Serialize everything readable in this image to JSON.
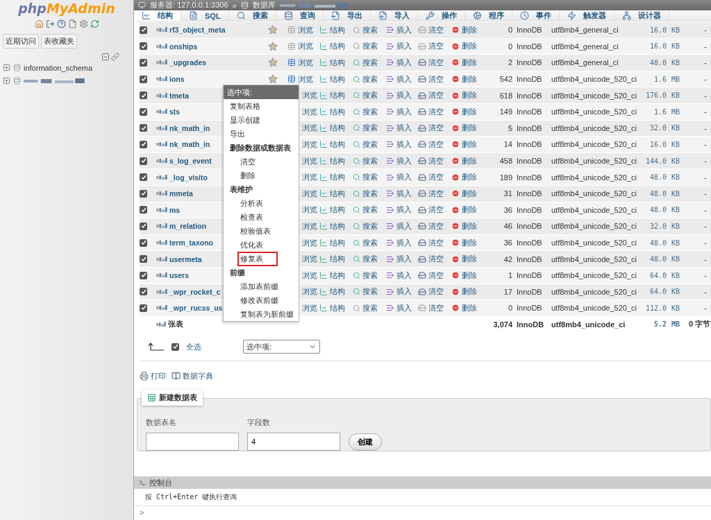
{
  "sidebar": {
    "logo": {
      "php": "php",
      "rest": "MyAdmin"
    },
    "buttons": [
      "近期访问",
      "表收藏夹"
    ],
    "tree": [
      {
        "label": "information_schema",
        "blurred": false
      },
      {
        "blurred": true
      }
    ]
  },
  "breadcrumb": {
    "server_label": "服务器:",
    "server": "127.0.0.1:3306",
    "separator": "»",
    "database_label": "数据库"
  },
  "tabs": [
    {
      "label": "结构",
      "kind": "structure",
      "selected": true
    },
    {
      "label": "SQL",
      "kind": "sql",
      "selected": false
    },
    {
      "label": "搜索",
      "kind": "search",
      "selected": false
    },
    {
      "label": "查询",
      "kind": "query",
      "selected": false
    },
    {
      "label": "导出",
      "kind": "export",
      "selected": false
    },
    {
      "label": "导入",
      "kind": "import",
      "selected": false
    },
    {
      "label": "操作",
      "kind": "operations",
      "selected": false
    },
    {
      "label": "程序",
      "kind": "routines",
      "selected": false
    },
    {
      "label": "事件",
      "kind": "events",
      "selected": false
    },
    {
      "label": "触发器",
      "kind": "triggers",
      "selected": false
    },
    {
      "label": "设计器",
      "kind": "designer",
      "selected": false
    }
  ],
  "rows": [
    {
      "name": "rf3_object_meta",
      "checked": true,
      "covered": false,
      "empty": true,
      "actions": [
        "浏览",
        "结构",
        "搜索",
        "插入",
        "清空",
        "删除"
      ],
      "rows": "0",
      "engine": "InnoDB",
      "collation": "utf8mb4_general_ci",
      "size": "16.0",
      "unit": "KB",
      "overhead": "-"
    },
    {
      "name": "onships",
      "checked": true,
      "covered": false,
      "empty": true,
      "actions": [
        "浏览",
        "结构",
        "搜索",
        "插入",
        "清空",
        "删除"
      ],
      "rows": "0",
      "engine": "InnoDB",
      "collation": "utf8mb4_general_ci",
      "size": "16.0",
      "unit": "KB",
      "overhead": "-"
    },
    {
      "name": "_upgrades",
      "checked": true,
      "covered": false,
      "empty": false,
      "actions": [
        "浏览",
        "结构",
        "搜索",
        "插入",
        "清空",
        "删除"
      ],
      "rows": "2",
      "engine": "InnoDB",
      "collation": "utf8mb4_general_ci",
      "size": "48.0",
      "unit": "KB",
      "overhead": "-"
    },
    {
      "name": "ions",
      "checked": true,
      "covered": false,
      "empty": false,
      "actions": [
        "浏览",
        "结构",
        "搜索",
        "插入",
        "清空",
        "删除"
      ],
      "rows": "542",
      "engine": "InnoDB",
      "collation": "utf8mb4_unicode_520_ci",
      "size": "1.6",
      "unit": "MB",
      "overhead": "-"
    },
    {
      "name": "tmeta",
      "checked": true,
      "covered": true,
      "empty": false,
      "actions": [
        "浏览",
        "结构",
        "搜索",
        "插入",
        "清空",
        "删除"
      ],
      "rows": "618",
      "engine": "InnoDB",
      "collation": "utf8mb4_unicode_520_ci",
      "size": "176.0",
      "unit": "KB",
      "overhead": "-"
    },
    {
      "name": "sts",
      "checked": true,
      "covered": true,
      "empty": false,
      "actions": [
        "浏览",
        "结构",
        "搜索",
        "插入",
        "清空",
        "删除"
      ],
      "rows": "149",
      "engine": "InnoDB",
      "collation": "utf8mb4_unicode_520_ci",
      "size": "1.6",
      "unit": "MB",
      "overhead": "-"
    },
    {
      "name": "nk_math_in",
      "checked": true,
      "covered": true,
      "empty": false,
      "actions": [
        "浏览",
        "结构",
        "搜索",
        "插入",
        "清空",
        "删除"
      ],
      "rows": "5",
      "engine": "InnoDB",
      "collation": "utf8mb4_unicode_520_ci",
      "size": "32.0",
      "unit": "KB",
      "overhead": "-"
    },
    {
      "name": "nk_math_in",
      "checked": true,
      "covered": true,
      "empty": false,
      "actions": [
        "浏览",
        "结构",
        "搜索",
        "插入",
        "清空",
        "删除"
      ],
      "rows": "14",
      "engine": "InnoDB",
      "collation": "utf8mb4_unicode_520_ci",
      "size": "16.0",
      "unit": "KB",
      "overhead": "-"
    },
    {
      "name": "s_log_event",
      "checked": true,
      "covered": true,
      "empty": false,
      "actions": [
        "浏览",
        "结构",
        "搜索",
        "插入",
        "清空",
        "删除"
      ],
      "rows": "458",
      "engine": "InnoDB",
      "collation": "utf8mb4_unicode_520_ci",
      "size": "144.0",
      "unit": "KB",
      "overhead": "-"
    },
    {
      "name": "_log_visito",
      "checked": true,
      "covered": true,
      "empty": false,
      "actions": [
        "浏览",
        "结构",
        "搜索",
        "插入",
        "清空",
        "删除"
      ],
      "rows": "189",
      "engine": "InnoDB",
      "collation": "utf8mb4_unicode_520_ci",
      "size": "48.0",
      "unit": "KB",
      "overhead": "-"
    },
    {
      "name": "mmeta",
      "checked": true,
      "covered": true,
      "empty": false,
      "actions": [
        "浏览",
        "结构",
        "搜索",
        "插入",
        "清空",
        "删除"
      ],
      "rows": "31",
      "engine": "InnoDB",
      "collation": "utf8mb4_unicode_520_ci",
      "size": "48.0",
      "unit": "KB",
      "overhead": "-"
    },
    {
      "name": "ms",
      "checked": true,
      "covered": true,
      "empty": false,
      "actions": [
        "浏览",
        "结构",
        "搜索",
        "插入",
        "清空",
        "删除"
      ],
      "rows": "36",
      "engine": "InnoDB",
      "collation": "utf8mb4_unicode_520_ci",
      "size": "48.0",
      "unit": "KB",
      "overhead": "-"
    },
    {
      "name": "m_relation",
      "checked": true,
      "covered": true,
      "empty": false,
      "actions": [
        "浏览",
        "结构",
        "搜索",
        "插入",
        "清空",
        "删除"
      ],
      "rows": "46",
      "engine": "InnoDB",
      "collation": "utf8mb4_unicode_520_ci",
      "size": "32.0",
      "unit": "KB",
      "overhead": "-"
    },
    {
      "name": "term_taxono",
      "checked": true,
      "covered": true,
      "empty": false,
      "actions": [
        "浏览",
        "结构",
        "搜索",
        "插入",
        "清空",
        "删除"
      ],
      "rows": "36",
      "engine": "InnoDB",
      "collation": "utf8mb4_unicode_520_ci",
      "size": "48.0",
      "unit": "KB",
      "overhead": "-"
    },
    {
      "name": "usermeta",
      "checked": true,
      "covered": true,
      "empty": false,
      "actions": [
        "浏览",
        "结构",
        "搜索",
        "插入",
        "清空",
        "删除"
      ],
      "rows": "42",
      "engine": "InnoDB",
      "collation": "utf8mb4_unicode_520_ci",
      "size": "48.0",
      "unit": "KB",
      "overhead": "-"
    },
    {
      "name": "users",
      "checked": true,
      "covered": true,
      "empty": false,
      "actions": [
        "浏览",
        "结构",
        "搜索",
        "插入",
        "清空",
        "删除"
      ],
      "rows": "1",
      "engine": "InnoDB",
      "collation": "utf8mb4_unicode_520_ci",
      "size": "64.0",
      "unit": "KB",
      "overhead": "-"
    },
    {
      "name": "_wpr_rocket_c",
      "checked": true,
      "covered": true,
      "empty": false,
      "actions": [
        "浏览",
        "结构",
        "搜索",
        "插入",
        "清空",
        "删除"
      ],
      "rows": "17",
      "engine": "InnoDB",
      "collation": "utf8mb4_unicode_520_ci",
      "size": "64.0",
      "unit": "KB",
      "overhead": "-"
    },
    {
      "name": "_wpr_rucss_us",
      "checked": true,
      "covered": true,
      "empty": true,
      "actions": [
        "浏览",
        "结构",
        "搜索",
        "插入",
        "清空",
        "删除"
      ],
      "rows": "0",
      "engine": "InnoDB",
      "collation": "utf8mb4_unicode_520_ci",
      "size": "112.0",
      "unit": "KB",
      "overhead": "-"
    }
  ],
  "total": {
    "label": "张表",
    "rows": "3,074",
    "engine": "InnoDB",
    "collation": "utf8mb4_unicode_ci",
    "size": "5.2",
    "unit": "MB",
    "overhead": "0 字节"
  },
  "bulk": {
    "check_all": {
      "label": "全选",
      "checked": true
    },
    "select": "选中项:"
  },
  "menu": {
    "header": "选中项:",
    "items": [
      {
        "label": "复制表格",
        "kind": "item",
        "highlighted": false
      },
      {
        "label": "显示创建",
        "kind": "item",
        "highlighted": false
      },
      {
        "label": "导出",
        "kind": "item",
        "highlighted": false
      },
      {
        "label": "删除数据或数据表",
        "kind": "heading",
        "highlighted": false
      },
      {
        "label": "清空",
        "kind": "subitem",
        "highlighted": false
      },
      {
        "label": "删除",
        "kind": "subitem",
        "highlighted": false
      },
      {
        "label": "表维护",
        "kind": "heading",
        "highlighted": false
      },
      {
        "label": "分析表",
        "kind": "subitem",
        "highlighted": false
      },
      {
        "label": "检查表",
        "kind": "subitem",
        "highlighted": false
      },
      {
        "label": "校验值表",
        "kind": "subitem",
        "highlighted": false
      },
      {
        "label": "优化表",
        "kind": "subitem",
        "highlighted": false
      },
      {
        "label": "修复表",
        "kind": "subitem",
        "highlighted": true
      },
      {
        "label": "前缀",
        "kind": "heading",
        "highlighted": false
      },
      {
        "label": "添加表前缀",
        "kind": "subitem",
        "highlighted": false
      },
      {
        "label": "修改表前缀",
        "kind": "subitem",
        "highlighted": false
      },
      {
        "label": "复制表为新前缀",
        "kind": "subitem",
        "highlighted": false
      }
    ]
  },
  "links": [
    "打印",
    "数据字典"
  ],
  "create_table": {
    "title": "新建数据表",
    "name_label": "数据表名",
    "fields_label": "字段数",
    "fields_value": "4",
    "button": "创建"
  },
  "console": {
    "title": "控制台",
    "hint": "按 Ctrl+Enter 键执行查询",
    "prompt": ">"
  }
}
